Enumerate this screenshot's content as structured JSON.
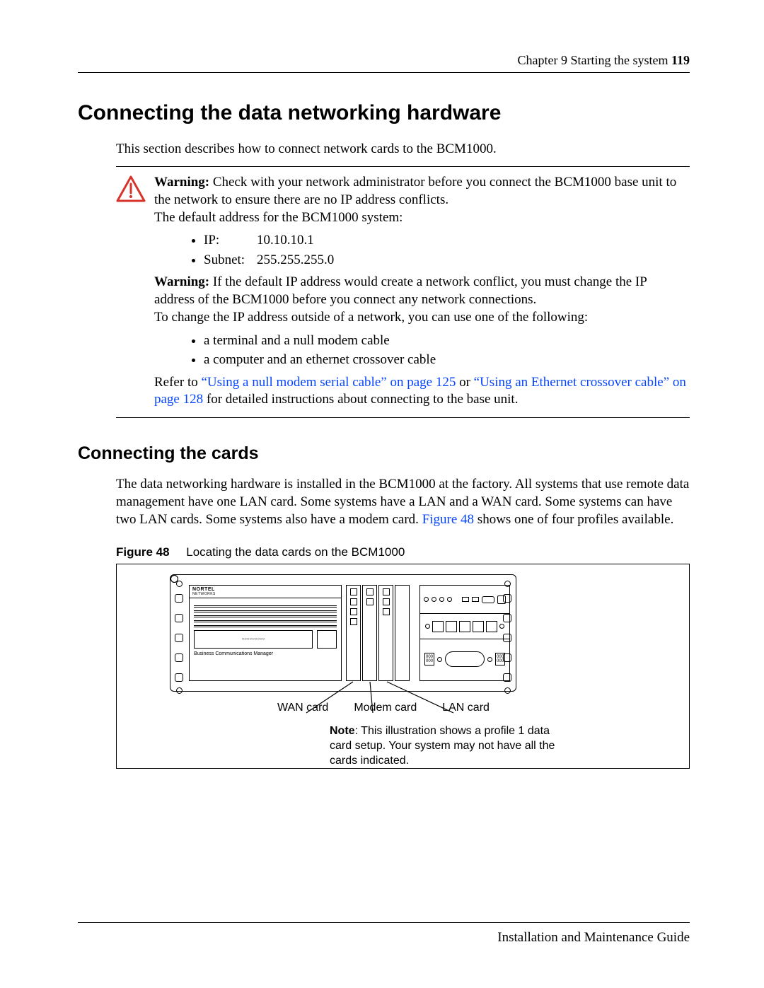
{
  "header": {
    "chapter": "Chapter 9 Starting the system",
    "page_number": "119"
  },
  "h1": "Connecting the data networking hardware",
  "intro": "This section describes how to connect network cards to the BCM1000.",
  "warning": {
    "w1_label": "Warning:",
    "w1_text": " Check with your network administrator before you connect the BCM1000 base unit to the network to ensure there are no IP address conflicts.",
    "default_line": "The default address for the BCM1000 system:",
    "ip_label": "IP:",
    "ip_value": "10.10.10.1",
    "subnet_label": "Subnet:",
    "subnet_value": "255.255.255.0",
    "w2_label": "Warning:",
    "w2_text": " If the default IP address would create a network conflict, you must change the IP address of the BCM1000 before you connect any network connections.",
    "change_line": "To change the IP address outside of a network, you can use one of the following:",
    "method1": "a terminal and a null modem cable",
    "method2": "a computer and an ethernet crossover cable",
    "refer_pre": "Refer to ",
    "link1": "“Using a null modem serial cable” on page 125",
    "refer_mid": " or ",
    "link2": "“Using an Ethernet crossover cable” on page 128",
    "refer_post": " for detailed instructions about connecting to the base unit."
  },
  "h2": "Connecting the cards",
  "cards_para_pre": "The data networking hardware is installed in the BCM1000 at the factory. All systems that use remote data management have one LAN card. Some systems have a LAN and a WAN card. Some systems can have two LAN cards. Some systems also have a modem card. ",
  "cards_para_link": "Figure 48",
  "cards_para_post": " shows one of four profiles available.",
  "fig": {
    "label": "Figure 48",
    "caption": "Locating the data cards on the BCM1000",
    "brand1": "NORTEL",
    "brand2": "NETWORKS",
    "bcm_label": "Business Communications Manager",
    "callout_wan": "WAN card",
    "callout_modem": "Modem card",
    "callout_lan": "LAN card",
    "note_label": "Note",
    "note_text": ": This illustration shows a profile 1 data card setup. Your system may not have all the cards indicated."
  },
  "footer": "Installation and Maintenance Guide"
}
